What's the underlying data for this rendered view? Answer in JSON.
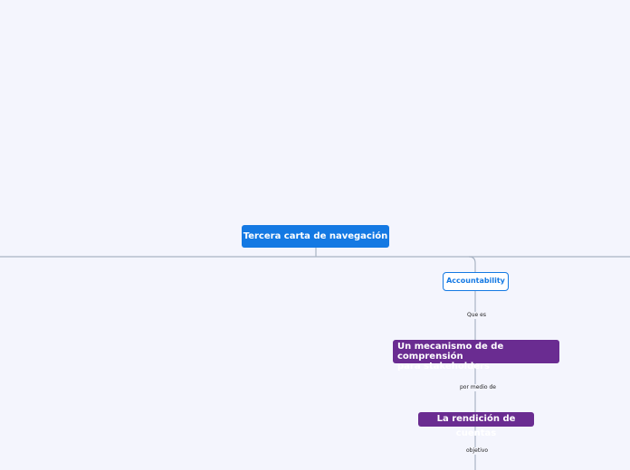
{
  "map": {
    "root": "Tercera carta de navegación",
    "topic": "Accountability",
    "link1": "Que es",
    "node1": "Un mecanismo de de comprensión\npara stakeholders",
    "link2": "por medio de",
    "node2": "La rendición de cuentas",
    "link3": "objetivo"
  },
  "colors": {
    "background": "#f4f5fd",
    "root_fill": "#1479e3",
    "topic_border": "#1479e3",
    "subtopic_fill": "#6a2c91",
    "connector": "#a9b4c4"
  }
}
